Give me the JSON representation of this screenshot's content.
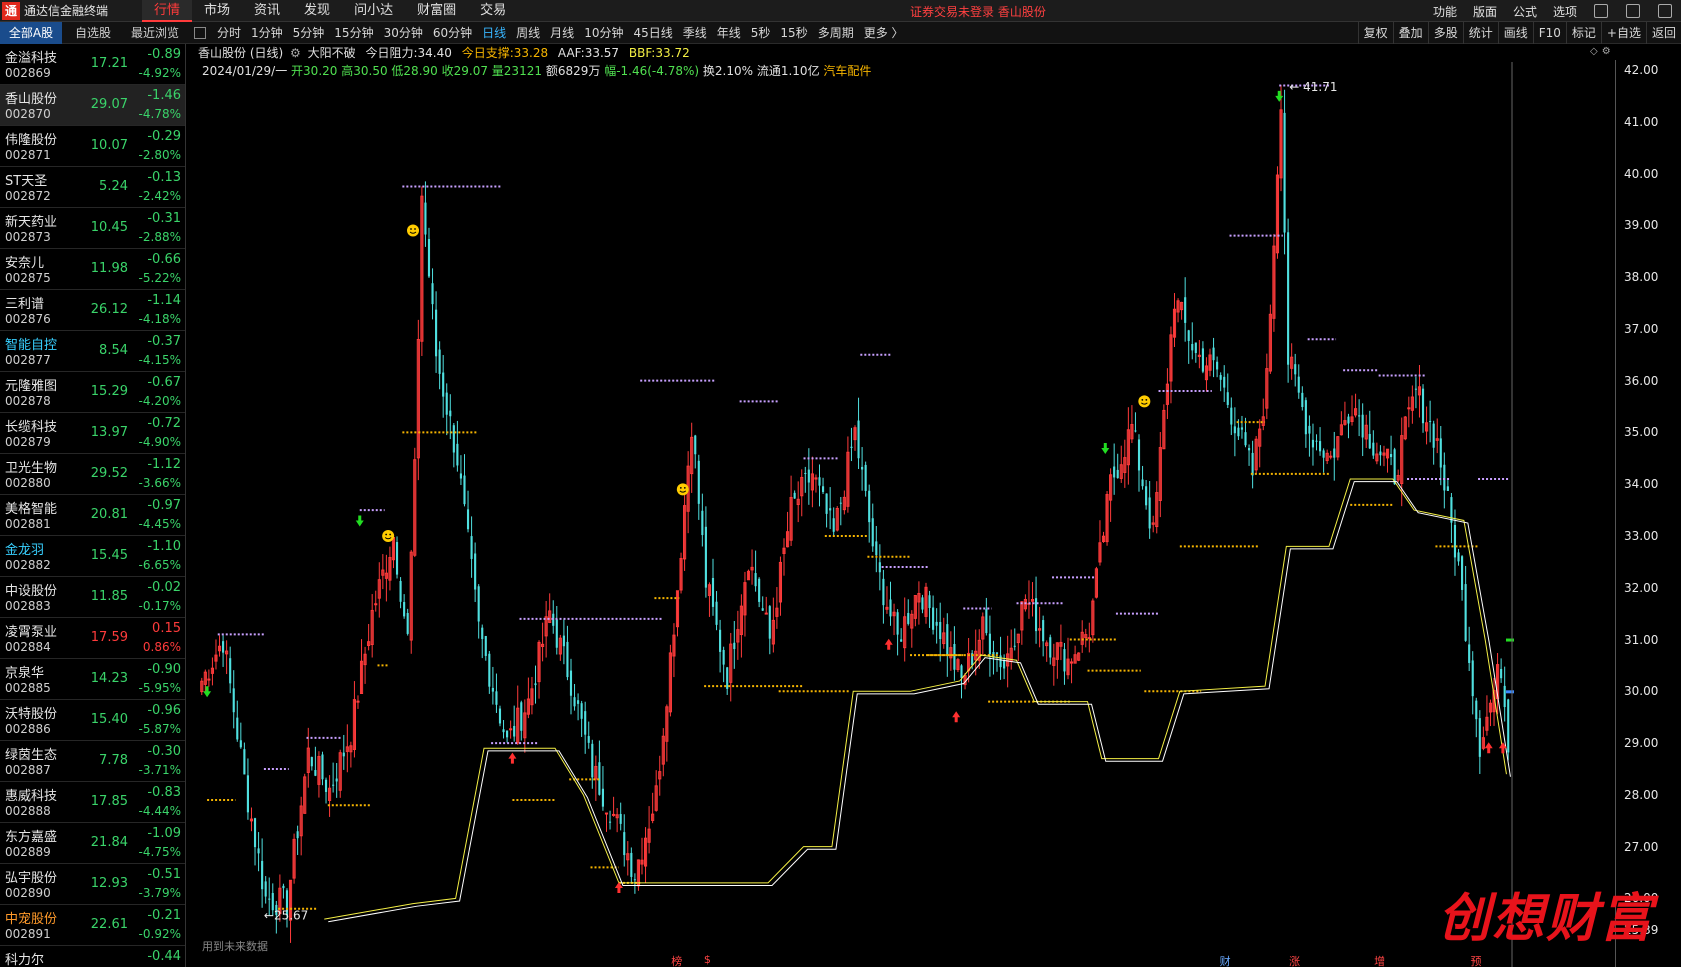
{
  "app": {
    "logo_glyph": "通",
    "title": "通达信金融终端",
    "menu": [
      "行情",
      "市场",
      "资讯",
      "发现",
      "问小达",
      "财富圈",
      "交易"
    ],
    "active_menu": 0,
    "notice": "证券交易未登录   香山股份",
    "right_menu": [
      "功能",
      "版面",
      "公式",
      "选项"
    ],
    "right_icons": [
      "refresh-icon",
      "window-icon",
      "layout-icon"
    ]
  },
  "toolbar": {
    "stock_tabs": [
      "全部A股",
      "自选股",
      "最近浏览"
    ],
    "periods": [
      "分时",
      "1分钟",
      "5分钟",
      "15分钟",
      "30分钟",
      "60分钟",
      "日线",
      "周线",
      "月线",
      "10分钟",
      "45日线",
      "季线",
      "年线",
      "5秒",
      "15秒",
      "多周期",
      "更多 〉"
    ],
    "active_period": 6,
    "right_tools": [
      "复权",
      "叠加",
      "多股",
      "统计",
      "画线",
      "F10",
      "标记",
      "+自选",
      "返回"
    ]
  },
  "stocks": [
    {
      "name": "金溢科技",
      "code": "002869",
      "price": "17.21",
      "chg": "-0.89",
      "pct": "-4.92%",
      "dir": "down"
    },
    {
      "name": "香山股份",
      "code": "002870",
      "price": "29.07",
      "chg": "-1.46",
      "pct": "-4.78%",
      "dir": "down",
      "selected": true
    },
    {
      "name": "伟隆股份",
      "code": "002871",
      "price": "10.07",
      "chg": "-0.29",
      "pct": "-2.80%",
      "dir": "down"
    },
    {
      "name": "ST天圣",
      "code": "002872",
      "price": "5.24",
      "chg": "-0.13",
      "pct": "-2.42%",
      "dir": "down"
    },
    {
      "name": "新天药业",
      "code": "002873",
      "price": "10.45",
      "chg": "-0.31",
      "pct": "-2.88%",
      "dir": "down"
    },
    {
      "name": "安奈儿",
      "code": "002875",
      "price": "11.98",
      "chg": "-0.66",
      "pct": "-5.22%",
      "dir": "down"
    },
    {
      "name": "三利谱",
      "code": "002876",
      "price": "26.12",
      "chg": "-1.14",
      "pct": "-4.18%",
      "dir": "down"
    },
    {
      "name": "智能自控",
      "code": "002877",
      "price": "8.54",
      "chg": "-0.37",
      "pct": "-4.15%",
      "dir": "down",
      "highlight": "cyan"
    },
    {
      "name": "元隆雅图",
      "code": "002878",
      "price": "15.29",
      "chg": "-0.67",
      "pct": "-4.20%",
      "dir": "down"
    },
    {
      "name": "长缆科技",
      "code": "002879",
      "price": "13.97",
      "chg": "-0.72",
      "pct": "-4.90%",
      "dir": "down"
    },
    {
      "name": "卫光生物",
      "code": "002880",
      "price": "29.52",
      "chg": "-1.12",
      "pct": "-3.66%",
      "dir": "down"
    },
    {
      "name": "美格智能",
      "code": "002881",
      "price": "20.81",
      "chg": "-0.97",
      "pct": "-4.45%",
      "dir": "down"
    },
    {
      "name": "金龙羽",
      "code": "002882",
      "price": "15.45",
      "chg": "-1.10",
      "pct": "-6.65%",
      "dir": "down",
      "highlight": "cyan"
    },
    {
      "name": "中设股份",
      "code": "002883",
      "price": "11.85",
      "chg": "-0.02",
      "pct": "-0.17%",
      "dir": "down"
    },
    {
      "name": "凌霄泵业",
      "code": "002884",
      "price": "17.59",
      "chg": "0.15",
      "pct": "0.86%",
      "dir": "up"
    },
    {
      "name": "京泉华",
      "code": "002885",
      "price": "14.23",
      "chg": "-0.90",
      "pct": "-5.95%",
      "dir": "down"
    },
    {
      "name": "沃特股份",
      "code": "002886",
      "price": "15.40",
      "chg": "-0.96",
      "pct": "-5.87%",
      "dir": "down"
    },
    {
      "name": "绿茵生态",
      "code": "002887",
      "price": "7.78",
      "chg": "-0.30",
      "pct": "-3.71%",
      "dir": "down"
    },
    {
      "name": "惠威科技",
      "code": "002888",
      "price": "17.85",
      "chg": "-0.83",
      "pct": "-4.44%",
      "dir": "down"
    },
    {
      "name": "东方嘉盛",
      "code": "002889",
      "price": "21.84",
      "chg": "-1.09",
      "pct": "-4.75%",
      "dir": "down"
    },
    {
      "name": "弘宇股份",
      "code": "002890",
      "price": "12.93",
      "chg": "-0.51",
      "pct": "-3.79%",
      "dir": "down"
    },
    {
      "name": "中宠股份",
      "code": "002891",
      "price": "22.61",
      "chg": "-0.21",
      "pct": "-0.92%",
      "dir": "down",
      "highlight": "orange"
    },
    {
      "name": "科力尔",
      "code": "",
      "price": "",
      "chg": "-0.44",
      "pct": "",
      "dir": "down"
    }
  ],
  "chart_head": {
    "title": "香山股份 (日线)",
    "indicator": "大阳不破",
    "resist_label": "今日阻力:",
    "resist": "34.40",
    "support_label": "今日支撑:",
    "support": "33.28",
    "aaf_label": "AAF:",
    "aaf": "33.57",
    "bbf_label": "BBF:",
    "bbf": "33.72",
    "date": "2024/01/29/一",
    "open": "开30.20",
    "high": "高30.50",
    "low": "低28.90",
    "close": "收29.07",
    "volume": "量23121",
    "amount": "额6829万",
    "range": "幅-1.46(-4.78%)",
    "turnover": "换2.10%",
    "float": "流通1.10亿",
    "sector": "汽车配件"
  },
  "chart_data": {
    "type": "candlestick",
    "y_ticks": [
      "42.00",
      "41.00",
      "40.00",
      "39.00",
      "38.00",
      "37.00",
      "36.00",
      "35.00",
      "34.00",
      "33.00",
      "32.00",
      "31.00",
      "30.00",
      "29.00",
      "28.00",
      "27.00",
      "26.00"
    ],
    "y_range": [
      25.39,
      42.0
    ],
    "last_price": "25.39",
    "high_label": "41.71",
    "low_label": "25.67",
    "future_data_note": "用到未来数据",
    "bottom_marks": [
      {
        "text": "榜",
        "pos": 0.334,
        "color": "red"
      },
      {
        "text": "$",
        "pos": 0.357,
        "color": "red"
      },
      {
        "text": "财",
        "pos": 0.721,
        "color": "blue"
      },
      {
        "text": "涨",
        "pos": 0.77,
        "color": "red"
      },
      {
        "text": "增",
        "pos": 0.83,
        "color": "red"
      },
      {
        "text": "预",
        "pos": 0.898,
        "color": "red"
      }
    ],
    "colors": {
      "up": "#ff3b3b",
      "down": "#50e0e0",
      "support": "#f5b400",
      "resist": "#c8a0ff",
      "line": "#f5f045"
    }
  },
  "watermark": "创想财富"
}
